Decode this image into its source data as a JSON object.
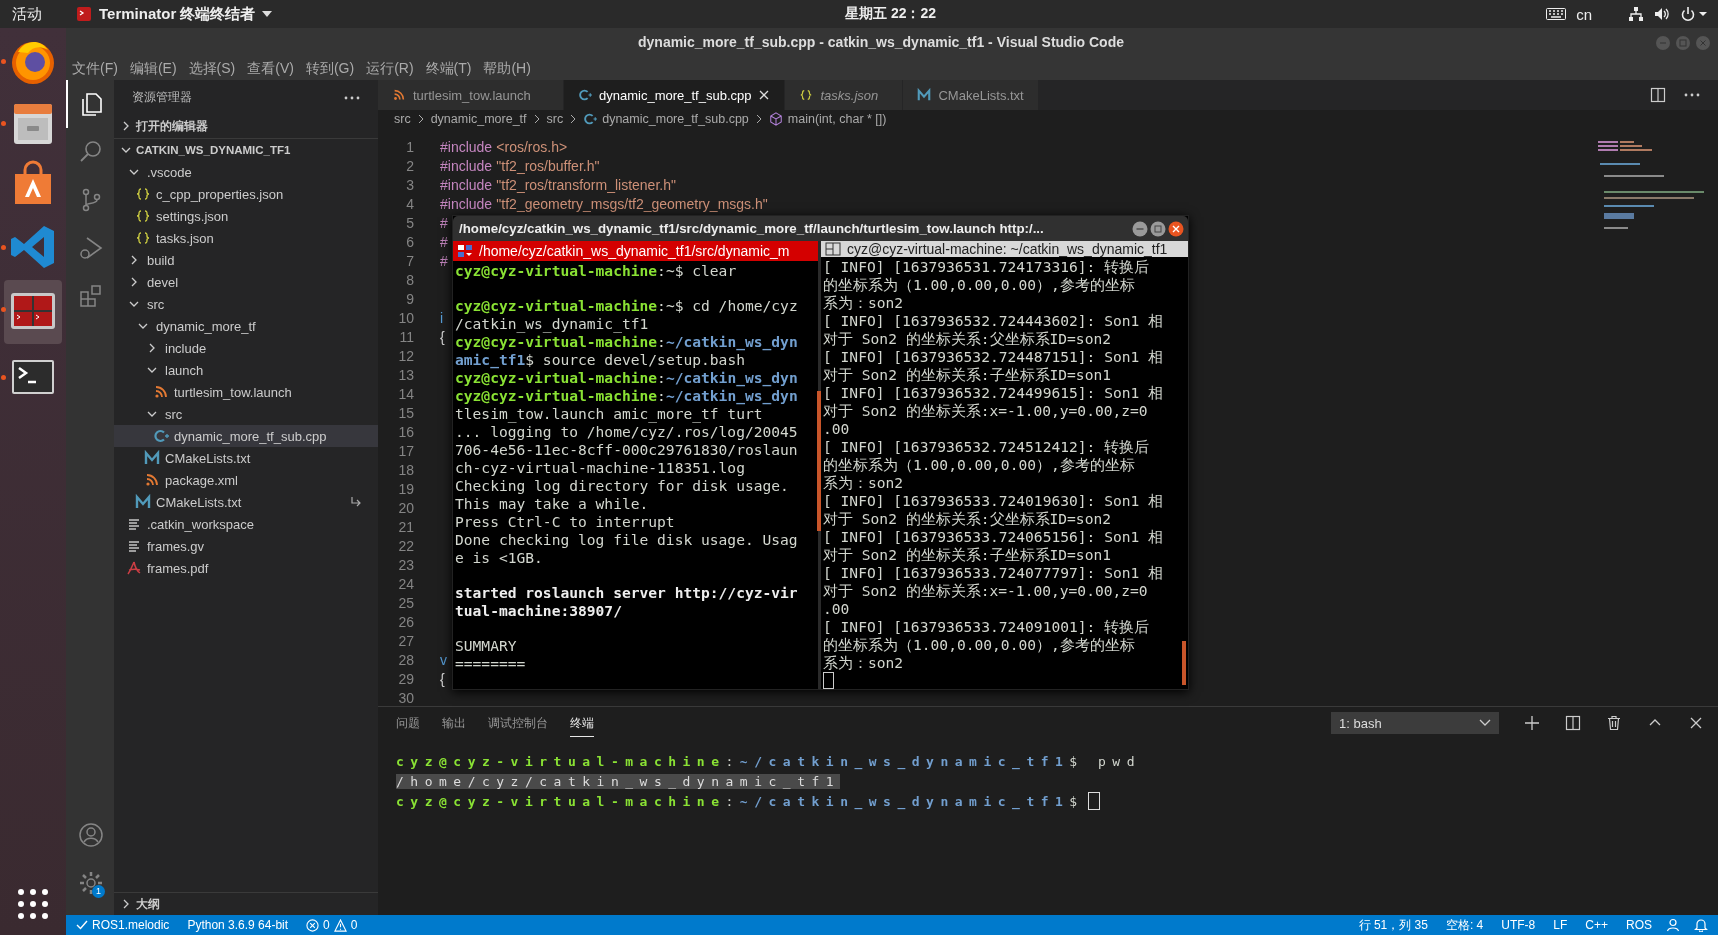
{
  "topbar": {
    "activities": "活动",
    "app": "Terminator 终端终结者",
    "clock": "星期五 22：22",
    "input_method": "cn"
  },
  "dock": [
    {
      "kind": "firefox",
      "running": true,
      "selected": false
    },
    {
      "kind": "files",
      "running": true,
      "selected": false
    },
    {
      "kind": "software",
      "running": false,
      "selected": false
    },
    {
      "kind": "vscode",
      "running": true,
      "selected": false
    },
    {
      "kind": "terminator",
      "running": true,
      "selected": true
    },
    {
      "kind": "terminal",
      "running": true,
      "selected": false
    }
  ],
  "window": {
    "title": "dynamic_more_tf_sub.cpp - catkin_ws_dynamic_tf1 - Visual Studio Code"
  },
  "menu": [
    "文件(F)",
    "编辑(E)",
    "选择(S)",
    "查看(V)",
    "转到(G)",
    "运行(R)",
    "终端(T)",
    "帮助(H)"
  ],
  "activity_bar": [
    {
      "kind": "explorer",
      "selected": true
    },
    {
      "kind": "search",
      "selected": false
    },
    {
      "kind": "scm",
      "selected": false
    },
    {
      "kind": "debug",
      "selected": false
    },
    {
      "kind": "extensions",
      "selected": false
    }
  ],
  "settings_badge": "1",
  "sidebar": {
    "title": "资源管理器",
    "open_editors": {
      "label": "打开的编辑器",
      "expanded": false
    },
    "workspace": {
      "label": "CATKIN_WS_DYNAMIC_TF1",
      "expanded": true
    },
    "tree": [
      {
        "label": ".vscode",
        "kind": "folder",
        "expanded": true,
        "selected": false,
        "children": [
          {
            "label": "c_cpp_properties.json",
            "kind": "json",
            "selected": false
          },
          {
            "label": "settings.json",
            "kind": "json",
            "selected": false
          },
          {
            "label": "tasks.json",
            "kind": "json",
            "selected": false
          }
        ]
      },
      {
        "label": "build",
        "kind": "folder",
        "expanded": false,
        "selected": false
      },
      {
        "label": "devel",
        "kind": "folder",
        "expanded": false,
        "selected": false
      },
      {
        "label": "src",
        "kind": "folder",
        "expanded": true,
        "selected": false,
        "children": [
          {
            "label": "dynamic_more_tf",
            "kind": "folder",
            "expanded": true,
            "selected": false,
            "symlink": false,
            "children": [
              {
                "label": "include",
                "kind": "folder",
                "expanded": false,
                "selected": false
              },
              {
                "label": "launch",
                "kind": "folder",
                "expanded": true,
                "selected": false,
                "children": [
                  {
                    "label": "turtlesim_tow.launch",
                    "kind": "rss",
                    "selected": false
                  }
                ]
              },
              {
                "label": "src",
                "kind": "folder",
                "expanded": true,
                "selected": false,
                "children": [
                  {
                    "label": "dynamic_more_tf_sub.cpp",
                    "kind": "cpp",
                    "selected": true
                  }
                ]
              },
              {
                "label": "CMakeLists.txt",
                "kind": "cmake",
                "selected": false
              },
              {
                "label": "package.xml",
                "kind": "rss",
                "selected": false
              }
            ]
          },
          {
            "label": "CMakeLists.txt",
            "kind": "cmake",
            "selected": false,
            "symlink": true
          }
        ]
      },
      {
        "label": ".catkin_workspace",
        "kind": "text",
        "selected": false
      },
      {
        "label": "frames.gv",
        "kind": "text",
        "selected": false
      },
      {
        "label": "frames.pdf",
        "kind": "pdf",
        "selected": false
      }
    ],
    "outline": {
      "label": "大纲",
      "expanded": false
    }
  },
  "tabs": [
    {
      "label": "turtlesim_tow.launch",
      "kind": "rss",
      "selected": false,
      "preview": false
    },
    {
      "label": "dynamic_more_tf_sub.cpp",
      "kind": "cpp",
      "selected": true,
      "preview": false
    },
    {
      "label": "tasks.json",
      "kind": "json",
      "selected": false,
      "preview": true
    },
    {
      "label": "CMakeLists.txt",
      "kind": "cmake",
      "selected": false,
      "preview": false
    }
  ],
  "breadcrumb": [
    {
      "label": "src",
      "kind": "folder"
    },
    {
      "label": "dynamic_more_tf",
      "kind": "folder"
    },
    {
      "label": "src",
      "kind": "folder"
    },
    {
      "label": "dynamic_more_tf_sub.cpp",
      "kind": "cpp"
    },
    {
      "label": "main(int, char * [])",
      "kind": "symbol"
    }
  ],
  "code": [
    {
      "n": "1",
      "segs": [
        {
          "kind": "keyword",
          "text": "#include"
        },
        {
          "kind": "string",
          "text": "<ros/ros.h>"
        }
      ]
    },
    {
      "n": "2",
      "segs": [
        {
          "kind": "keyword",
          "text": "#include"
        },
        {
          "kind": "string",
          "text": "\"tf2_ros/buffer.h\""
        }
      ]
    },
    {
      "n": "3",
      "segs": [
        {
          "kind": "keyword",
          "text": "#include"
        },
        {
          "kind": "string",
          "text": "\"tf2_ros/transform_listener.h\""
        }
      ]
    },
    {
      "n": "4",
      "segs": [
        {
          "kind": "keyword",
          "text": "#include"
        },
        {
          "kind": "string",
          "text": "\"tf2_geometry_msgs/tf2_geometry_msgs.h\""
        }
      ]
    },
    {
      "n": "5",
      "segs": [
        {
          "kind": "keyword",
          "text": "#"
        }
      ]
    },
    {
      "n": "6",
      "segs": [
        {
          "kind": "keyword",
          "text": "#"
        }
      ]
    },
    {
      "n": "7",
      "segs": [
        {
          "kind": "keyword",
          "text": "#"
        }
      ]
    },
    {
      "n": "8"
    },
    {
      "n": "9"
    },
    {
      "n": "10",
      "segs": [
        {
          "kind": "type",
          "text": "i"
        }
      ]
    },
    {
      "n": "11",
      "segs": [
        {
          "kind": "plain",
          "text": "{"
        }
      ]
    },
    {
      "n": "12"
    },
    {
      "n": "13"
    },
    {
      "n": "14"
    },
    {
      "n": "15"
    },
    {
      "n": "16"
    },
    {
      "n": "17"
    },
    {
      "n": "18"
    },
    {
      "n": "19"
    },
    {
      "n": "20"
    },
    {
      "n": "21"
    },
    {
      "n": "22"
    },
    {
      "n": "23"
    },
    {
      "n": "24"
    },
    {
      "n": "25"
    },
    {
      "n": "26"
    },
    {
      "n": "27"
    },
    {
      "n": "28",
      "segs": [
        {
          "kind": "type",
          "text": "v"
        }
      ]
    },
    {
      "n": "29",
      "segs": [
        {
          "kind": "plain",
          "text": "{"
        }
      ]
    },
    {
      "n": "30"
    }
  ],
  "terminator": {
    "title": "/home/cyz/catkin_ws_dynamic_tf1/src/dynamic_more_tf/launch/turtlesim_tow.launch http:/...",
    "left": {
      "header": "/home/cyz/catkin_ws_dynamic_tf1/src/dynamic_m",
      "focused": true,
      "lines": [
        {
          "segs": [
            {
              "kind": "user",
              "text": "cyz@cyz-virtual-machine"
            },
            {
              "kind": "text",
              "text": ":~$ clear"
            }
          ]
        },
        {
          "gap": true,
          "segs": [
            {
              "kind": "user",
              "text": "cyz@cyz-virtual-machine"
            },
            {
              "kind": "text",
              "text": ":~$ cd /home/cyz"
            }
          ]
        },
        {
          "segs": [
            {
              "kind": "text",
              "text": "/catkin_ws_dynamic_tf1"
            }
          ]
        },
        {
          "segs": [
            {
              "kind": "user",
              "text": "cyz@cyz-virtual-machine"
            },
            {
              "kind": "text",
              "text": ":"
            },
            {
              "kind": "path",
              "text": "~/catkin_ws_dyn"
            }
          ]
        },
        {
          "segs": [
            {
              "kind": "path",
              "text": "amic_tf1"
            },
            {
              "kind": "text",
              "text": "$ source devel/setup.bash"
            }
          ]
        },
        {
          "segs": [
            {
              "kind": "user",
              "text": "cyz@cyz-virtual-machine"
            },
            {
              "kind": "text",
              "text": ":"
            },
            {
              "kind": "path",
              "text": "~/catkin_ws_dyn"
            }
          ]
        },
        {
          "segs": [
            {
              "kind": "user",
              "text": "cyz@cyz-virtual-machine"
            },
            {
              "kind": "text",
              "text": ":"
            },
            {
              "kind": "path",
              "text": "~/catkin_ws_dyn"
            }
          ]
        },
        {
          "segs": [
            {
              "kind": "text",
              "text": "tlesim_tow.launch amic_more_tf turt"
            }
          ]
        },
        {
          "segs": [
            {
              "kind": "text",
              "text": "... logging to /home/cyz/.ros/log/20045"
            }
          ]
        },
        {
          "segs": [
            {
              "kind": "text",
              "text": "706-4e56-11ec-8cff-000c29761830/roslaun"
            }
          ]
        },
        {
          "segs": [
            {
              "kind": "text",
              "text": "ch-cyz-virtual-machine-118351.log"
            }
          ]
        },
        {
          "segs": [
            {
              "kind": "text",
              "text": "Checking log directory for disk usage."
            }
          ]
        },
        {
          "segs": [
            {
              "kind": "text",
              "text": "This may take a while."
            }
          ]
        },
        {
          "segs": [
            {
              "kind": "text",
              "text": "Press Ctrl-C to interrupt"
            }
          ]
        },
        {
          "segs": [
            {
              "kind": "text",
              "text": "Done checking log file disk usage. Usag"
            }
          ]
        },
        {
          "segs": [
            {
              "kind": "text",
              "text": "e is <1GB."
            }
          ]
        },
        {
          "gap": true,
          "segs": [
            {
              "kind": "bold",
              "text": "started roslaunch server http://cyz-vir"
            }
          ]
        },
        {
          "segs": [
            {
              "kind": "bold",
              "text": "tual-machine:38907/"
            }
          ]
        },
        {
          "gap": true,
          "segs": [
            {
              "kind": "text",
              "text": "SUMMARY"
            }
          ]
        },
        {
          "segs": [
            {
              "kind": "text",
              "text": "========"
            }
          ]
        }
      ]
    },
    "right": {
      "header": "cyz@cyz-virtual-machine: ~/catkin_ws_dynamic_tf1",
      "focused": false,
      "lines": [
        "[ INFO] [1637936531.724173316]: 转换后",
        "的坐标系为（1.00,0.00,0.00）,参考的坐标",
        "系为：son2",
        "[ INFO] [1637936532.724443602]: Son1 相",
        "对于 Son2 的坐标关系:父坐标系ID=son2",
        "[ INFO] [1637936532.724487151]: Son1 相",
        "对于 Son2 的坐标关系:子坐标系ID=son1",
        "[ INFO] [1637936532.724499615]: Son1 相",
        "对于 Son2 的坐标关系:x=-1.00,y=0.00,z=0",
        ".00",
        "[ INFO] [1637936532.724512412]: 转换后",
        "的坐标系为（1.00,0.00,0.00）,参考的坐标",
        "系为：son2",
        "[ INFO] [1637936533.724019630]: Son1 相",
        "对于 Son2 的坐标关系:父坐标系ID=son2",
        "[ INFO] [1637936533.724065156]: Son1 相",
        "对于 Son2 的坐标关系:子坐标系ID=son1",
        "[ INFO] [1637936533.724077797]: Son1 相",
        "对于 Son2 的坐标关系:x=-1.00,y=0.00,z=0",
        ".00",
        "[ INFO] [1637936533.724091001]: 转换后",
        "的坐标系为（1.00,0.00,0.00）,参考的坐标",
        "系为：son2"
      ]
    }
  },
  "panel": {
    "tabs": [
      {
        "label": "问题",
        "selected": false
      },
      {
        "label": "输出",
        "selected": false
      },
      {
        "label": "调试控制台",
        "selected": false
      },
      {
        "label": "终端",
        "selected": true
      }
    ],
    "terminal_select": "1: bash",
    "lines": [
      {
        "segs": [
          {
            "kind": "user",
            "text": "cyz@cyz-virtual-machine"
          },
          {
            "kind": "text",
            "text": ":"
          },
          {
            "kind": "path",
            "text": "~/catkin_ws_dynamic_tf1"
          },
          {
            "kind": "text",
            "text": "$ pwd"
          }
        ]
      },
      {
        "segs": [
          {
            "kind": "selected",
            "text": "/home/cyz/catkin_ws_dynamic_tf1"
          }
        ]
      },
      {
        "cursor": true,
        "segs": [
          {
            "kind": "user",
            "text": "cyz@cyz-virtual-machine"
          },
          {
            "kind": "text",
            "text": ":"
          },
          {
            "kind": "path",
            "text": "~/catkin_ws_dynamic_tf1"
          },
          {
            "kind": "text",
            "text": "$"
          }
        ]
      }
    ]
  },
  "status_bar": {
    "left": [
      {
        "kind": "check",
        "text": "ROS1.melodic"
      },
      {
        "kind": "plain",
        "text": "Python 3.6.9 64-bit"
      }
    ],
    "errors": "0",
    "warnings": "0",
    "right": [
      "行 51，列 35",
      "空格: 4",
      "UTF-8",
      "LF",
      "C++",
      "ROS"
    ]
  }
}
